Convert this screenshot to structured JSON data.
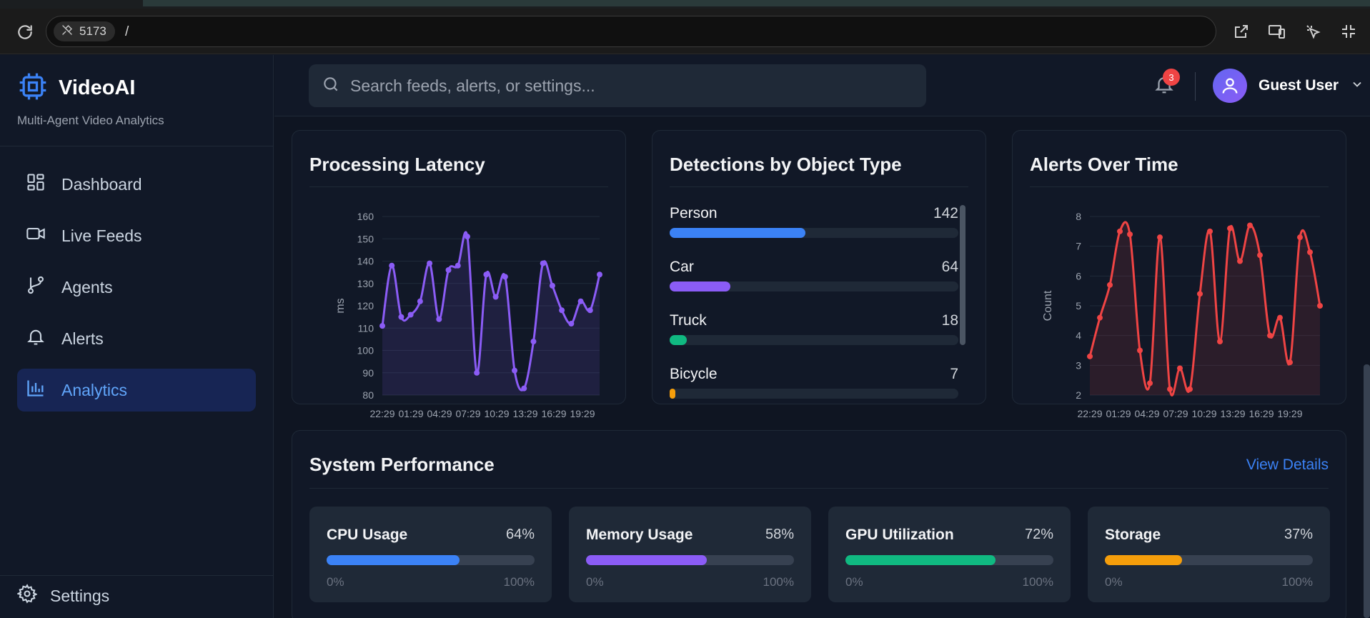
{
  "browser": {
    "port": "5173",
    "path": "/"
  },
  "sidebar": {
    "brand_name": "VideoAI",
    "brand_sub": "Multi-Agent Video Analytics",
    "items": [
      {
        "label": "Dashboard",
        "icon": "dashboard-icon"
      },
      {
        "label": "Live Feeds",
        "icon": "video-icon"
      },
      {
        "label": "Agents",
        "icon": "branch-icon"
      },
      {
        "label": "Alerts",
        "icon": "bell-icon"
      },
      {
        "label": "Analytics",
        "icon": "bar-chart-icon",
        "active": true
      }
    ],
    "settings_label": "Settings"
  },
  "header": {
    "search_placeholder": "Search feeds, alerts, or settings...",
    "notification_count": "3",
    "user_name": "Guest User"
  },
  "latency": {
    "title": "Processing Latency"
  },
  "detections": {
    "title": "Detections by Object Type",
    "items": [
      {
        "name": "Person",
        "count": "142",
        "fraction": 0.47,
        "color": "#3b82f6"
      },
      {
        "name": "Car",
        "count": "64",
        "fraction": 0.21,
        "color": "#8b5cf6"
      },
      {
        "name": "Truck",
        "count": "18",
        "fraction": 0.06,
        "color": "#10b981"
      },
      {
        "name": "Bicycle",
        "count": "7",
        "fraction": 0.02,
        "color": "#f59e0b"
      }
    ]
  },
  "alerts_chart": {
    "title": "Alerts Over Time"
  },
  "performance": {
    "title": "System Performance",
    "link": "View Details",
    "min_label": "0%",
    "max_label": "100%",
    "metrics": [
      {
        "label": "CPU Usage",
        "value": "64%",
        "fraction": 0.64,
        "color": "#3b82f6"
      },
      {
        "label": "Memory Usage",
        "value": "58%",
        "fraction": 0.58,
        "color": "#8b5cf6"
      },
      {
        "label": "GPU Utilization",
        "value": "72%",
        "fraction": 0.72,
        "color": "#10b981"
      },
      {
        "label": "Storage",
        "value": "37%",
        "fraction": 0.37,
        "color": "#f59e0b"
      }
    ]
  },
  "chart_data": [
    {
      "type": "area",
      "title": "Processing Latency",
      "xlabel": "",
      "ylabel": "ms",
      "ylim": [
        80,
        160
      ],
      "yticks": [
        80,
        90,
        100,
        110,
        120,
        130,
        140,
        150,
        160
      ],
      "xticks": [
        "22:29",
        "01:29",
        "04:29",
        "07:29",
        "10:29",
        "13:29",
        "16:29",
        "19:29"
      ],
      "color": "#8b5cf6",
      "grid": true,
      "series": [
        {
          "values": [
            111,
            138,
            115,
            116,
            122,
            139,
            114,
            136,
            138,
            151,
            90,
            134,
            124,
            133,
            91,
            83,
            104,
            139,
            129,
            118,
            112,
            122,
            118,
            134
          ]
        }
      ]
    },
    {
      "type": "bar",
      "title": "Detections by Object Type",
      "orientation": "horizontal",
      "categories": [
        "Person",
        "Car",
        "Truck",
        "Bicycle"
      ],
      "values": [
        142,
        64,
        18,
        7
      ]
    },
    {
      "type": "area",
      "title": "Alerts Over Time",
      "xlabel": "",
      "ylabel": "Count",
      "ylim": [
        2,
        8
      ],
      "yticks": [
        2,
        3,
        4,
        5,
        6,
        7,
        8
      ],
      "xticks": [
        "22:29",
        "01:29",
        "04:29",
        "07:29",
        "10:29",
        "13:29",
        "16:29",
        "19:29"
      ],
      "color": "#ef4444",
      "grid": true,
      "series": [
        {
          "values": [
            3.3,
            4.6,
            5.7,
            7.5,
            7.4,
            3.5,
            2.4,
            7.3,
            2.2,
            2.9,
            2.2,
            5.4,
            7.5,
            3.8,
            7.6,
            6.5,
            7.7,
            6.7,
            4.0,
            4.6,
            3.1,
            7.3,
            6.8,
            5.0
          ]
        }
      ]
    }
  ]
}
